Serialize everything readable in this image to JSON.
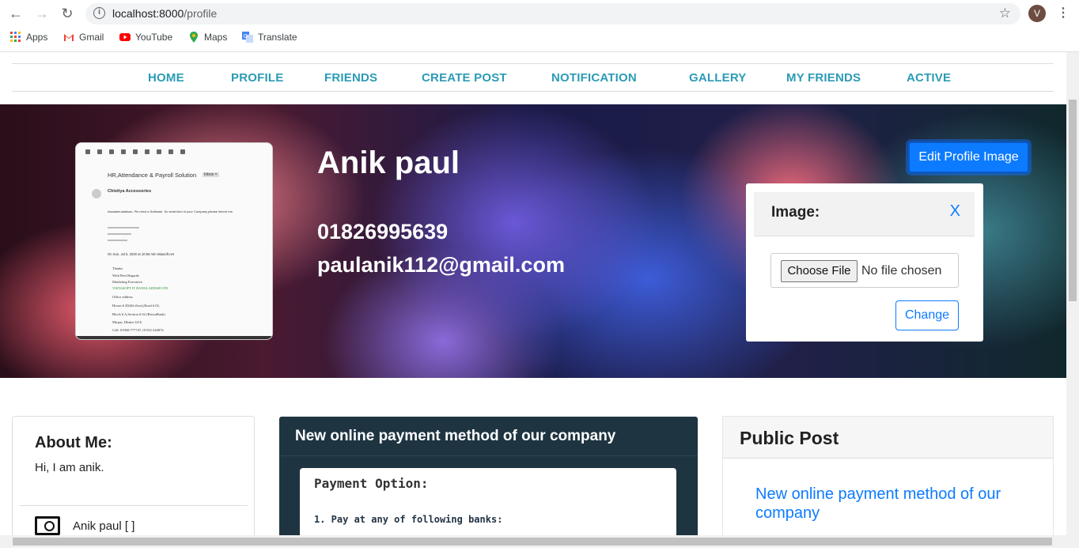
{
  "browser": {
    "url_host": "localhost:8000",
    "url_path": "/profile",
    "avatar_letter": "V",
    "bookmarks": [
      {
        "label": "Apps",
        "icon": "apps-grid-icon"
      },
      {
        "label": "Gmail",
        "icon": "gmail-icon"
      },
      {
        "label": "YouTube",
        "icon": "youtube-icon"
      },
      {
        "label": "Maps",
        "icon": "maps-pin-icon"
      },
      {
        "label": "Translate",
        "icon": "translate-icon"
      }
    ]
  },
  "nav": {
    "items": [
      "HOME",
      "PROFILE",
      "FRIENDS",
      "CREATE POST",
      "NOTIFICATION",
      "GALLERY",
      "MY FRIENDS",
      "ACTIVE"
    ],
    "color": "#2b9bb5"
  },
  "profile": {
    "name": "Anik paul",
    "phone": "01826995639",
    "email": "paulanik112@gmail.com",
    "image_doc": {
      "subject": "HR,Attendance & Payroll Solution",
      "tag": "Inbox ×",
      "sender": "Chistiya Accessories",
      "lines": [
        "Assalamualaikum, Pls need a Software. So what kind of your Company please inform me.",
        "On Sun, Jul 5, 2020 at 10:56 AM vistasoft.net",
        "Thanks",
        "With Best Regards",
        "Marketing Executive",
        "VISTASOFT IT BANGLADESH LTD.",
        "Office address",
        "House # 20(4th floor),Road # 02,",
        "Block # A,Section # 02 (BiswaBank)",
        "Mirpur, Dhaka-1216",
        "Cell: 01960-777747, 01552-344874"
      ]
    }
  },
  "edit_image": {
    "button_label": "Edit Profile Image",
    "modal_title": "Image:",
    "close_label": "X",
    "file_button": "Choose File",
    "file_status": "No file chosen",
    "submit_label": "Change"
  },
  "about": {
    "title": "About Me:",
    "bio": "Hi, I am anik.",
    "user_line": "Anik paul [ ]"
  },
  "post": {
    "title": "New online payment method of our company",
    "image_heading": "Payment Option:",
    "image_subheading": "1. Pay at any of following banks:"
  },
  "public_post": {
    "title": "Public Post",
    "link": "New online payment method of our company"
  },
  "colors": {
    "accent": "#0d7bff",
    "post_card_bg": "#1e3441"
  }
}
